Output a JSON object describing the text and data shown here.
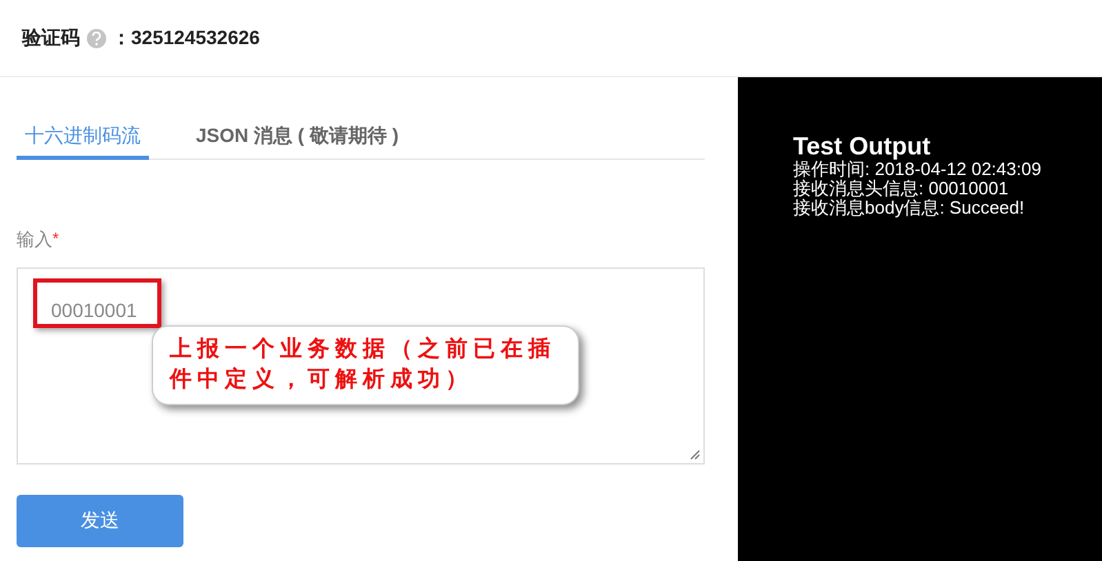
{
  "header": {
    "label": "验证码",
    "separator": "：",
    "code": "325124532626"
  },
  "tabs": [
    {
      "label": "十六进制码流",
      "selected": true
    },
    {
      "label": "JSON 消息 ( 敬请期待 )",
      "selected": false
    }
  ],
  "form": {
    "label": "输入",
    "required_mark": "*",
    "value": "00010001",
    "callout": "上报一个业务数据（之前已在插件中定义，可解析成功）",
    "submit": "发送"
  },
  "output": {
    "title": "Test Output",
    "lines": [
      "操作时间: 2018-04-12 02:43:09",
      "接收消息头信息: 00010001",
      "接收消息body信息: Succeed!"
    ]
  }
}
